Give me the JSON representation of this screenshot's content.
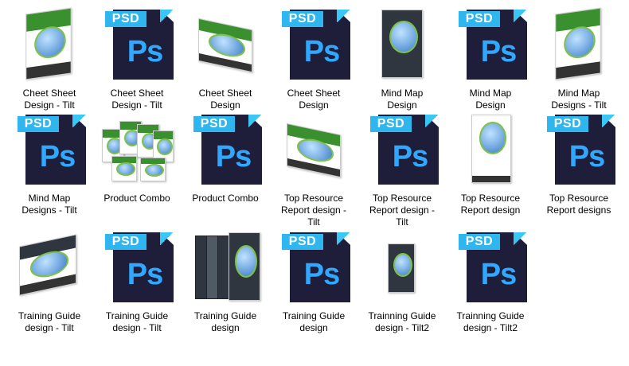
{
  "files": [
    {
      "name": "Cheet Sheet\nDesign - Tilt",
      "kind": "image-tilt"
    },
    {
      "name": "Cheet Sheet\nDesign - Tilt",
      "kind": "psd"
    },
    {
      "name": "Cheet Sheet\nDesign",
      "kind": "image"
    },
    {
      "name": "Cheet Sheet\nDesign",
      "kind": "psd"
    },
    {
      "name": "Mind Map\nDesign",
      "kind": "image"
    },
    {
      "name": "Mind Map\nDesign",
      "kind": "psd"
    },
    {
      "name": "Mind Map\nDesigns - Tilt",
      "kind": "image-tilt"
    },
    {
      "name": "Mind Map\nDesigns - Tilt",
      "kind": "psd"
    },
    {
      "name": "Product Combo",
      "kind": "image-combo"
    },
    {
      "name": "Product Combo",
      "kind": "psd"
    },
    {
      "name": "Top Resource\nReport design -\nTilt",
      "kind": "image-tilt"
    },
    {
      "name": "Top Resource\nReport design -\nTilt",
      "kind": "psd"
    },
    {
      "name": "Top Resource\nReport design",
      "kind": "image"
    },
    {
      "name": "Top Resource\nReport designs",
      "kind": "psd"
    },
    {
      "name": "Training Guide\ndesign - Tilt",
      "kind": "image-book"
    },
    {
      "name": "Training Guide\ndesign - Tilt",
      "kind": "psd"
    },
    {
      "name": "Training Guide\ndesign",
      "kind": "image-box"
    },
    {
      "name": "Training Guide\ndesign",
      "kind": "psd"
    },
    {
      "name": "Trainning Guide\ndesign - Tilt2",
      "kind": "image-small"
    },
    {
      "name": "Trainning Guide\ndesign - Tilt2",
      "kind": "psd"
    }
  ],
  "psd_tag": "PSD",
  "psd_mark": "Ps"
}
